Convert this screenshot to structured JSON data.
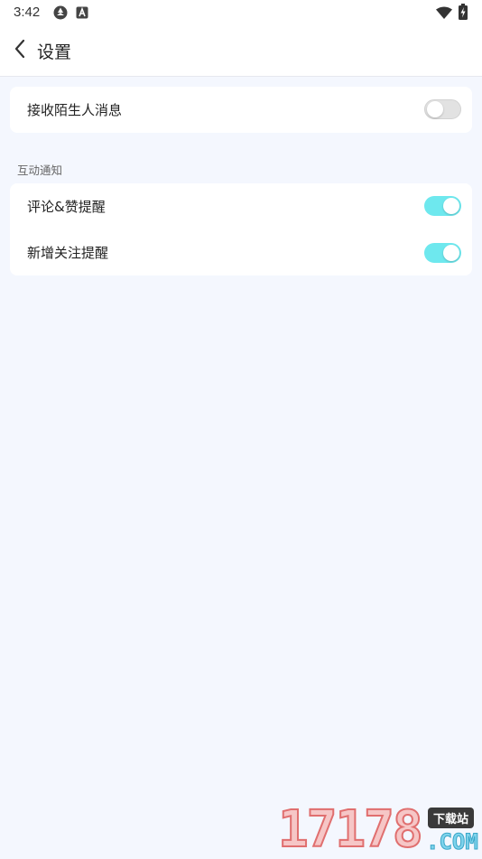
{
  "status_bar": {
    "time": "3:42",
    "icons": [
      "sync-icon",
      "a-letter-icon",
      "wifi-icon",
      "battery-charging-icon"
    ]
  },
  "header": {
    "back_icon": "chevron-left-icon",
    "title": "设置"
  },
  "stranger_card": {
    "items": [
      {
        "label": "接收陌生人消息",
        "enabled": false
      }
    ]
  },
  "interaction_section": {
    "title": "互动通知",
    "items": [
      {
        "label": "评论&赞提醒",
        "enabled": true
      },
      {
        "label": "新增关注提醒",
        "enabled": true
      }
    ]
  },
  "colors": {
    "background": "#f4f7fe",
    "card": "#ffffff",
    "toggle_on": "#6ee8ee",
    "toggle_off": "#e2e2e2"
  },
  "watermark": {
    "digits": "17178",
    "badge": "下载站",
    "suffix": ".COM"
  }
}
